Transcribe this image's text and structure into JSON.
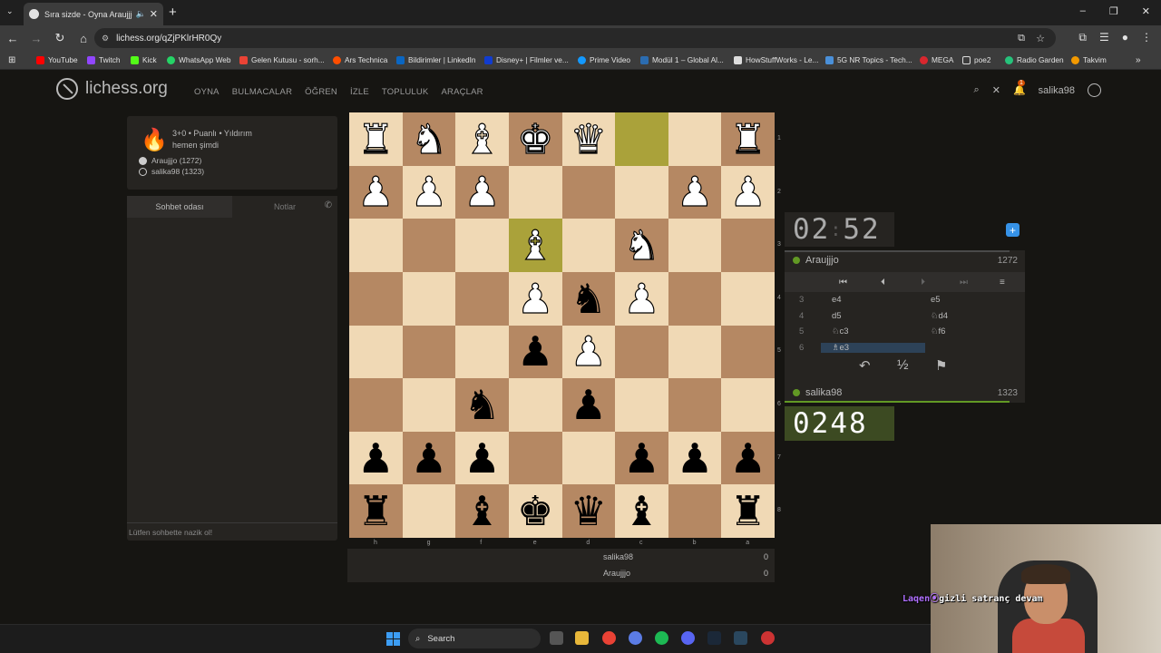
{
  "browser": {
    "tab_title": "Sıra sizde - Oyna Araujjjo",
    "url": "lichess.org/qZjPKlrHR0Qy",
    "bookmarks": [
      "YouTube",
      "Twitch",
      "Kick",
      "WhatsApp Web",
      "Gelen Kutusu - sorh...",
      "Ars Technica",
      "Bildirimler | LinkedIn",
      "Disney+ | Filmler ve...",
      "Prime Video",
      "Modül 1 – Global Al...",
      "HowStuffWorks - Le...",
      "5G NR Topics - Tech...",
      "MEGA",
      "poe2",
      "Radio Garden",
      "Takvim"
    ]
  },
  "site": {
    "logo": "lichess.org",
    "nav": [
      "OYNA",
      "BULMACALAR",
      "ÖĞREN",
      "İZLE",
      "TOPLULUK",
      "ARAÇLAR"
    ],
    "username": "salika98",
    "notification_count": "1"
  },
  "game_info": {
    "mode": "3+0 • Puanlı • Yıldırım",
    "time": "hemen şimdi",
    "player_white": "Araujjjo (1272)",
    "player_black": "salika98 (1323)"
  },
  "chat": {
    "tab_room": "Sohbet odası",
    "tab_notes": "Notlar",
    "placeholder": "Lütfen sohbette nazik ol!"
  },
  "board": {
    "ranks": [
      "1",
      "2",
      "3",
      "4",
      "5",
      "6",
      "7",
      "8"
    ],
    "files": [
      "h",
      "g",
      "f",
      "e",
      "d",
      "c",
      "b",
      "a"
    ],
    "rows": [
      [
        "wR",
        "wN",
        "wB",
        "wK",
        "wQ",
        "",
        "",
        "wR"
      ],
      [
        "wP",
        "wP",
        "wP",
        "",
        "",
        "",
        "wP",
        "wP"
      ],
      [
        "",
        "",
        "",
        "wB",
        "",
        "wN",
        "",
        ""
      ],
      [
        "",
        "",
        "",
        "wP",
        "bN",
        "wP",
        "",
        ""
      ],
      [
        "",
        "",
        "",
        "bP",
        "wP",
        "",
        "",
        ""
      ],
      [
        "",
        "",
        "bN",
        "",
        "bP",
        "",
        "",
        ""
      ],
      [
        "bP",
        "bP",
        "bP",
        "",
        "",
        "bP",
        "bP",
        "bP"
      ],
      [
        "bR",
        "",
        "bB",
        "bK",
        "bQ",
        "bB",
        "",
        "bR"
      ]
    ],
    "last_move": [
      [
        0,
        5
      ],
      [
        2,
        3
      ]
    ]
  },
  "clock_top": {
    "min": "02",
    "sec": "52"
  },
  "clock_bottom": {
    "min": "02",
    "sec": "48"
  },
  "opponent": {
    "name": "Araujjjo",
    "rating": "1272"
  },
  "me": {
    "name": "salika98",
    "rating": "1323"
  },
  "moves": [
    {
      "n": "3",
      "w": "e4",
      "b": "e5"
    },
    {
      "n": "4",
      "w": "d5",
      "b": "♘d4"
    },
    {
      "n": "5",
      "w": "♘c3",
      "b": "♘f6"
    },
    {
      "n": "6",
      "w": "♗e3",
      "b": ""
    }
  ],
  "draw_label": "½",
  "scores": [
    {
      "name": "salika98",
      "score": "0"
    },
    {
      "name": "Araujjjo",
      "score": "0"
    }
  ],
  "taskbar": {
    "search": "Search"
  },
  "overlay": {
    "prefix": "Laqen",
    "text": "gizli satranç devam"
  }
}
